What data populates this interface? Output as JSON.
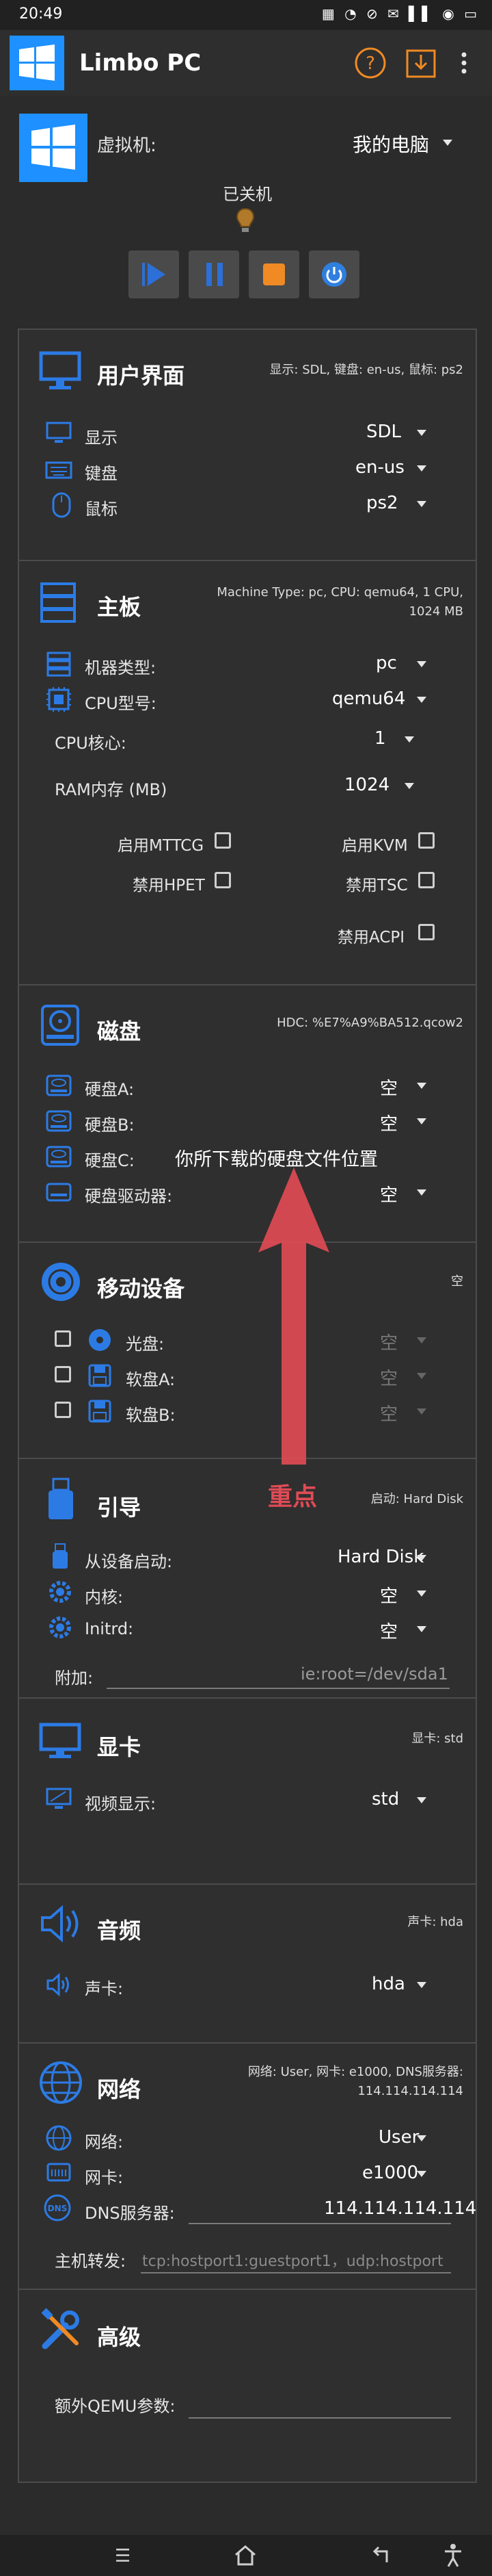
{
  "status": {
    "time": "20:49",
    "icons": "▦ ◔ ⊘ ✉ ▌▌ ◉ ▭"
  },
  "app": {
    "title": "Limbo PC"
  },
  "vm": {
    "label": "虚拟机:",
    "value": "我的电脑",
    "state": "已关机"
  },
  "ui": {
    "title": "用户界面",
    "summary": "显示: SDL, 键盘: en-us, 鼠标: ps2",
    "rows": [
      {
        "label": "显示",
        "value": "SDL"
      },
      {
        "label": "键盘",
        "value": "en-us"
      },
      {
        "label": "鼠标",
        "value": "ps2"
      }
    ]
  },
  "board": {
    "title": "主板",
    "summary": "Machine Type: pc, CPU: qemu64, 1 CPU, 1024 MB",
    "machine_label": "机器类型:",
    "machine_value": "pc",
    "cpu_label": "CPU型号:",
    "cpu_value": "qemu64",
    "cores_label": "CPU核心:",
    "cores_value": "1",
    "ram_label": "RAM内存 (MB)",
    "ram_value": "1024",
    "checks": [
      "启用MTTCG",
      "启用KVM",
      "禁用HPET",
      "禁用TSC",
      "禁用ACPI"
    ]
  },
  "disk": {
    "title": "磁盘",
    "summary": "HDC: %E7%A9%BA512.qcow2",
    "rows": [
      {
        "label": "硬盘A:",
        "value": "空"
      },
      {
        "label": "硬盘B:",
        "value": "空"
      },
      {
        "label": "硬盘C:",
        "value": ""
      },
      {
        "label": "硬盘驱动器:",
        "value": "空"
      }
    ],
    "overlay_note": "你所下载的硬盘文件位置"
  },
  "removable": {
    "title": "移动设备",
    "summary": "空",
    "rows": [
      {
        "label": "光盘:",
        "value": "空"
      },
      {
        "label": "软盘A:",
        "value": "空"
      },
      {
        "label": "软盘B:",
        "value": "空"
      }
    ],
    "annotation": "重点"
  },
  "boot": {
    "title": "引导",
    "summary": "启动: Hard Disk",
    "rows": [
      {
        "label": "从设备启动:",
        "value": "Hard Disk"
      },
      {
        "label": "内核:",
        "value": "空"
      },
      {
        "label": "Initrd:",
        "value": "空"
      }
    ],
    "append_label": "附加:",
    "append_value": "ie:root=/dev/sda1"
  },
  "gpu": {
    "title": "显卡",
    "summary": "显卡: std",
    "label": "视频显示:",
    "value": "std"
  },
  "audio": {
    "title": "音频",
    "summary": "声卡: hda",
    "label": "声卡:",
    "value": "hda"
  },
  "net": {
    "title": "网络",
    "summary": "网络: User, 网卡: e1000, DNS服务器: 114.114.114.114",
    "network_label": "网络:",
    "network_value": "User",
    "nic_label": "网卡:",
    "nic_value": "e1000",
    "dns_label": "DNS服务器:",
    "dns_value": "114.114.114.114",
    "fwd_label": "主机转发:",
    "fwd_placeholder": "tcp:hostport1:guestport1，udp:hostport"
  },
  "advanced": {
    "title": "高级",
    "qemu_label": "额外QEMU参数:",
    "qemu_value": ""
  },
  "colors": {
    "accent": "#2c7be5",
    "orange": "#f08a24",
    "annotation": "#e04b55"
  }
}
